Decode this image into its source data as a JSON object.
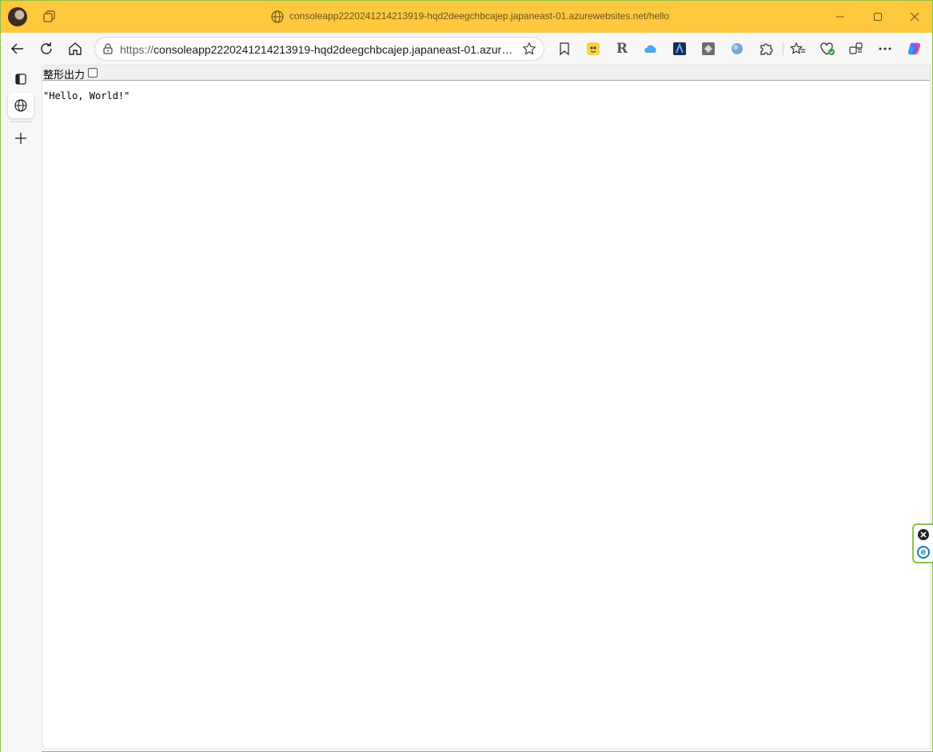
{
  "window": {
    "title": "consoleapp2220241214213919-hqd2deegchbcajep.japaneast-01.azurewebsites.net/hello",
    "accent_color": "#ffc83d",
    "border_color": "#8bc34a"
  },
  "toolbar": {
    "back_icon": "back-arrow-icon",
    "refresh_icon": "refresh-icon",
    "home_icon": "home-icon",
    "address": {
      "protocol": "https://",
      "host_path": "consoleapp2220241214213919-hqd2deegchbcajep.japaneast-01.azure..."
    },
    "extensions": [
      "favorites-bar-icon",
      "extension-character-icon",
      "extension-r-icon",
      "onedrive-icon",
      "extension-dark-icon",
      "extension-gray-icon",
      "extension-blue-sphere-icon",
      "extensions-puzzle-icon",
      "favorites-icon",
      "browser-essentials-icon",
      "collections-icon",
      "more-icon",
      "copilot-icon"
    ]
  },
  "siderail": {
    "items": [
      "tab-actions-icon",
      "globe-tab-icon",
      "new-tab-icon"
    ]
  },
  "page": {
    "pretty_print_label": "整形出力",
    "pretty_print_checked": false,
    "json_text": "\"Hello, World!\""
  }
}
